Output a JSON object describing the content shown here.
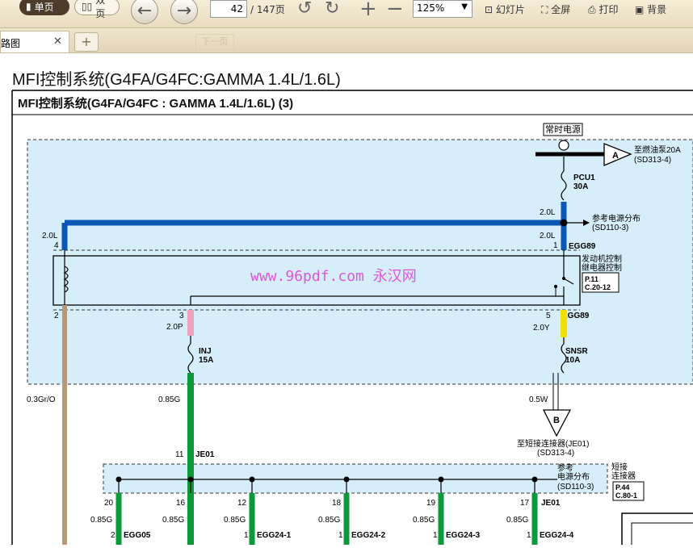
{
  "toolbar": {
    "single_page": "单页",
    "double_page": "双页",
    "page_current": "42",
    "page_total": "/ 147页",
    "zoom": "125%",
    "slideshow": "幻灯片",
    "fullscreen": "全屏",
    "print": "打印",
    "background": "背景"
  },
  "tabs": {
    "active_label": "电路图",
    "next_page_ghost": "下一页"
  },
  "doc": {
    "page_heading": "MFI控制系统(G4FA/G4FC:GAMMA 1.4L/1.6L)",
    "diagram_title": "MFI控制系统(G4FA/G4FC : GAMMA 1.4L/1.6L) (3)",
    "watermark": "www.96pdf.com 永汉网",
    "labels": {
      "hot_power": "常时电源",
      "to_fuel_pump_1": "至燃油泵20A",
      "to_fuel_pump_2": "(SD313-4)",
      "conn_a": "A",
      "pcu1_name": "PCU1",
      "pcu1_amp": "30A",
      "w20l_a": "2.0L",
      "w20l_b": "2.0L",
      "w20l_c": "2.0L",
      "ref_power_1": "参考电源分布",
      "ref_power_2": "(SD110-3)",
      "pin4": "4",
      "pin1": "1",
      "egg89_a": "EGG89",
      "relay_1": "发动机控制",
      "relay_2": "继电器控制",
      "p11": "P.11",
      "c2012": "C.20-12",
      "pin2": "2",
      "pin3": "3",
      "pin5": "5",
      "egg89_b": "EGG89",
      "w20p": "2.0P",
      "w20y": "2.0Y",
      "inj_name": "INJ",
      "inj_amp": "15A",
      "snsr_name": "SNSR",
      "snsr_amp": "10A",
      "w03gro": "0.3Gr/O",
      "w085g_top": "0.85G",
      "w05w": "0.5W",
      "conn_b": "B",
      "to_short_1": "至短接连接器(JE01)",
      "to_short_2": "(SD313-4)",
      "pin11": "11",
      "je01_a": "JE01",
      "ref2_1": "参考",
      "ref2_2": "电源分布",
      "ref2_3": "(SD110-3)",
      "short_1": "短接",
      "short_2": "连接器",
      "p44": "P.44",
      "c801": "C.80-1",
      "je01_b": "JE01"
    },
    "bottom_branches": [
      {
        "pin": "20",
        "wire": "0.85G",
        "cpin": "2",
        "conn": "EGG05"
      },
      {
        "pin": "16",
        "wire": "0.85G",
        "cpin": "",
        "conn": ""
      },
      {
        "pin": "12",
        "wire": "0.85G",
        "cpin": "1",
        "conn": "EGG24-1"
      },
      {
        "pin": "18",
        "wire": "0.85G",
        "cpin": "1",
        "conn": "EGG24-2"
      },
      {
        "pin": "19",
        "wire": "0.85G",
        "cpin": "1",
        "conn": "EGG24-3"
      },
      {
        "pin": "17",
        "wire": "0.85G",
        "cpin": "1",
        "conn": "EGG24-4"
      }
    ],
    "colors": {
      "blue_wire": "#0b57b4",
      "green_wire": "#0a9a3a",
      "pink_wire": "#eea3bd",
      "yellow_wire": "#f0e000",
      "tan_wire": "#b59a7a",
      "shade": "#d6eef9",
      "watermark": "#e23ad8"
    }
  }
}
